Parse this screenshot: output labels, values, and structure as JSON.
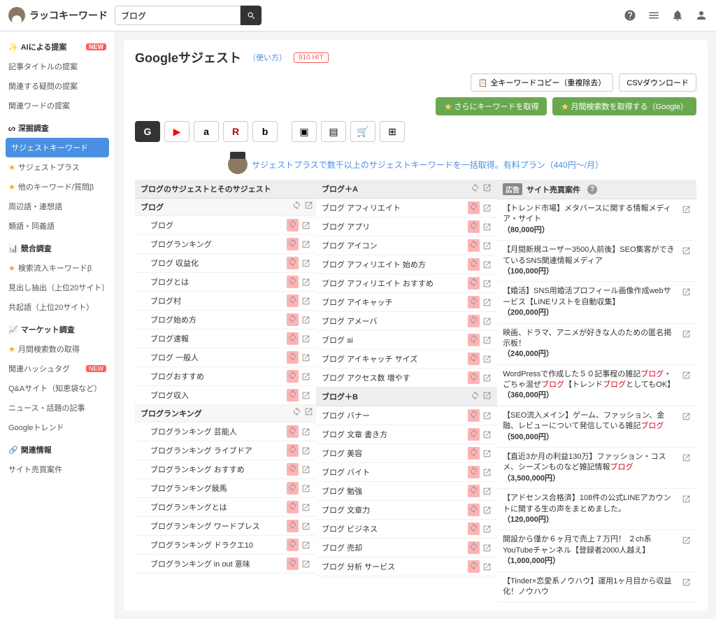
{
  "app": {
    "name": "ラッコキーワード"
  },
  "search": {
    "value": "ブログ"
  },
  "sidebar": {
    "ai": {
      "head": "AIによる提案",
      "items": [
        "記事タイトルの提案",
        "関連する疑問の提案",
        "関連ワードの提案"
      ]
    },
    "deep": {
      "head": "深掘調査",
      "items": [
        "サジェストキーワード",
        "サジェストプラス",
        "他のキーワード/質問β",
        "周辺語・連想語",
        "類語・同義語"
      ]
    },
    "comp": {
      "head": "競合調査",
      "items": [
        "検索流入キーワードβ",
        "見出し抽出（上位20サイト）",
        "共起語（上位20サイト）"
      ]
    },
    "market": {
      "head": "マーケット調査",
      "items": [
        "月間検索数の取得",
        "関連ハッシュタグ",
        "Q&Aサイト（知恵袋など）",
        "ニュース・話題の記事",
        "Googleトレンド"
      ]
    },
    "related": {
      "head": "関連情報",
      "items": [
        "サイト売買案件"
      ]
    }
  },
  "main": {
    "title": "Googleサジェスト",
    "usage": "（使い方）",
    "hit": "910 HIT",
    "copy_all": "全キーワードコピー（重複除去）",
    "csv": "CSVダウンロード",
    "more_kw": "さらにキーワードを取得",
    "monthly": "月間検索数を取得する（Google）",
    "promo": "サジェストプラスで数千以上のサジェストキーワードを一括取得。有料プラン（440円～/月）",
    "services": [
      "G",
      "▶",
      "a",
      "R",
      "b",
      "▣",
      "▤",
      "🛒",
      "⊞"
    ]
  },
  "col1": {
    "head": "ブログのサジェストとそのサジェスト",
    "sub1": "ブログ",
    "items1": [
      "ブログ",
      "ブログランキング",
      "ブログ 収益化",
      "ブログとは",
      "ブログ村",
      "ブログ始め方",
      "ブログ速報",
      "ブログ 一般人",
      "ブログおすすめ",
      "ブログ収入"
    ],
    "sub2": "ブログランキング",
    "items2": [
      "ブログランキング 芸能人",
      "ブログランキング ライブドア",
      "ブログランキング おすすめ",
      "ブログランキング競馬",
      "ブログランキングとは",
      "ブログランキング ワードプレス",
      "ブログランキング ドラクエ10",
      "ブログランキング in out 意味"
    ]
  },
  "col2": {
    "headA": "ブログ＋A",
    "itemsA": [
      "ブログ アフィリエイト",
      "ブログ アプリ",
      "ブログ アイコン",
      "ブログ アフィリエイト 始め方",
      "ブログ アフィリエイト おすすめ",
      "ブログ アイキャッチ",
      "ブログ アメーバ",
      "ブログ ai",
      "ブログ アイキャッチ サイズ",
      "ブログ アクセス数 増やす"
    ],
    "headB": "ブログ＋B",
    "itemsB": [
      "ブログ バナー",
      "ブログ 文章 書き方",
      "ブログ 美容",
      "ブログ バイト",
      "ブログ 勉強",
      "ブログ 文章力",
      "ブログ ビジネス",
      "ブログ 売却",
      "ブログ 分析 サービス"
    ]
  },
  "col3": {
    "adv": "広告",
    "head": "サイト売買案件",
    "items": [
      {
        "t": "【トレンド市場】メタバースに関する情報メディア・サイト",
        "p": "（80,000円）"
      },
      {
        "t": "【月間新規ユーザー3500人前後】SEO集客ができているSNS関連情報メディア",
        "p": "（100,000円）"
      },
      {
        "t": "【婚活】SNS用婚活プロフィール画像作成webサービス【LINEリストを自動収集】",
        "p": "（200,000円）"
      },
      {
        "t": "映画、ドラマ、アニメが好きな人のための匿名掲示板！",
        "p": "（240,000円）"
      },
      {
        "t": "WordPressで作成した５０記事程の雑記<red>ブログ</red>・ごちゃ混ぜ<red>ブログ</red>【トレンド<red>ブログ</red>としてもOK】",
        "p": "（360,000円）"
      },
      {
        "t": "【SEO流入メイン】ゲーム、ファッション、金融、レビューについて発信している雑記<red>ブログ</red>",
        "p": "（500,000円）"
      },
      {
        "t": "【直近3か月の利益130万】ファッション・コスメ、シーズンものなど雑記情報<red>ブログ</red>",
        "p": "（3,500,000円）"
      },
      {
        "t": "【アドセンス合格済】108件の公式LINEアカウントに関する生の声をまとめました。",
        "p": "（120,000円）"
      },
      {
        "t": "開設から僅か６ヶ月で売上７万円！ ２ch系YouTubeチャンネル【登録者2000人越え】",
        "p": "（1,000,000円）"
      },
      {
        "t": "【Tinder×恋愛系ノウハウ】運用1ヶ月目から収益化！ノウハウ",
        "p": ""
      }
    ]
  }
}
